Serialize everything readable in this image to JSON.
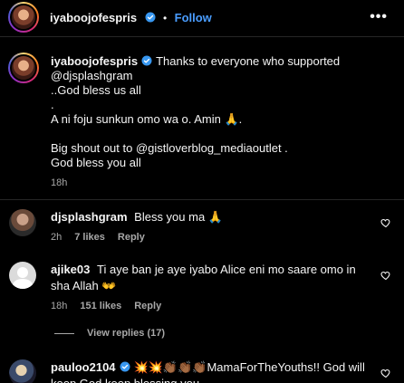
{
  "post": {
    "username": "iyaboojofespris",
    "separator": "•",
    "follow_label": "Follow",
    "more_label": "•••"
  },
  "caption": {
    "username": "iyaboojofespris",
    "lines": [
      "Thanks to everyone who supported",
      "@djsplashgram",
      "..God bless us all",
      ".",
      "A ni foju sunkun omo wa o. Amin 🙏.",
      "",
      "Big shout out to @gistloverblog_mediaoutlet .",
      "God bless you all"
    ],
    "time": "18h"
  },
  "comments": [
    {
      "username": "djsplashgram",
      "text": "Bless you ma 🙏",
      "time": "2h",
      "likes": "7 likes",
      "reply": "Reply"
    },
    {
      "username": "ajike03",
      "text": "Ti aye ban je aye iyabo Alice eni mo saare omo in sha Allah 👐",
      "time": "18h",
      "likes": "151 likes",
      "reply": "Reply"
    },
    {
      "username": "pauloo2104",
      "text": "💥💥👏🏾👏🏾👏🏾MamaForTheYouths!! God will",
      "text2": "keep God keep blessing you"
    }
  ],
  "view_replies": "View replies (17)",
  "colors": {
    "background": "#000000",
    "link": "#4a9dff",
    "muted": "#a8a8a8",
    "verified": "#3897f0"
  }
}
